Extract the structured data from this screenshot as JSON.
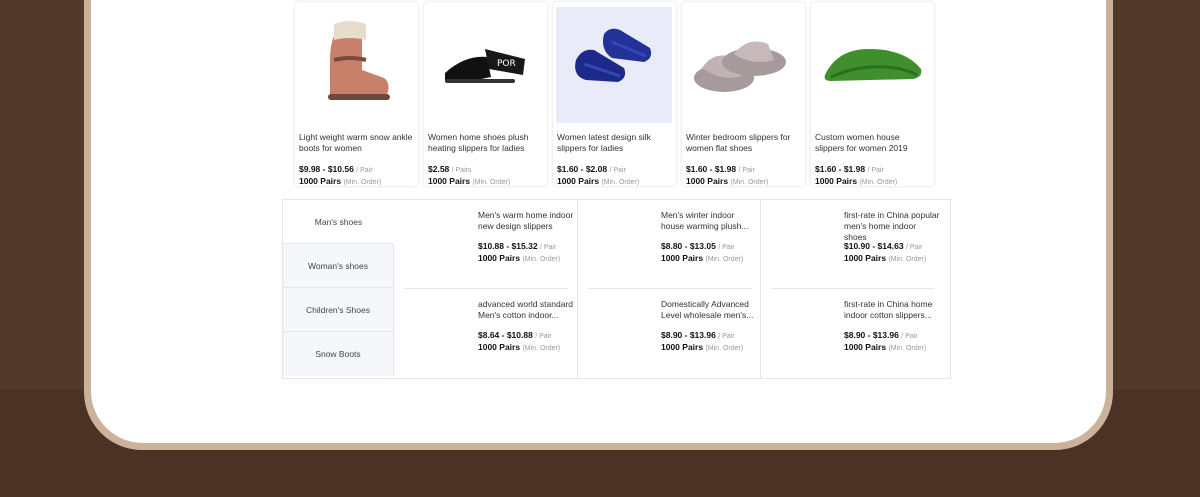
{
  "products": [
    {
      "title": "Light weight warm snow ankle boots for women",
      "price": "$9.98 - $10.56",
      "unit": "/ Pair",
      "moq": "1000 Pairs",
      "moq_note": "(Min. Order)",
      "icon": "snow-boot"
    },
    {
      "title": "Women home shoes plush heating slippers for ladies",
      "price": "$2.58",
      "unit": "/ Pairs",
      "moq": "1000 Pairs",
      "moq_note": "(Min. Order)",
      "icon": "sport-slide"
    },
    {
      "title": "Women latest design silk slippers for ladies",
      "price": "$1.60 - $2.08",
      "unit": "/ Pair",
      "moq": "1000 Pairs",
      "moq_note": "(Min. Order)",
      "icon": "silk-slipper"
    },
    {
      "title": "Winter bedroom slippers for women flat shoes",
      "price": "$1.60 - $1.98",
      "unit": "/ Pair",
      "moq": "1000 Pairs",
      "moq_note": "(Min. Order)",
      "icon": "fur-slipper"
    },
    {
      "title": "Custom women house slippers for women 2019",
      "price": "$1.60 - $1.98",
      "unit": "/ Pair",
      "moq": "1000 Pairs",
      "moq_note": "(Min. Order)",
      "icon": "grass-slipper"
    }
  ],
  "categories": [
    "Man's shoes",
    "Woman's shoes",
    "Children's Shoes",
    "Snow Boots"
  ],
  "category_products": [
    {
      "title": "Men's warm home indoor new design slippers",
      "price": "$10.88 - $15.32",
      "unit": "/ Pair",
      "moq": "1000 Pairs",
      "moq_note": "(Min. Order)"
    },
    {
      "title": "Men's winter indoor house warming plush...",
      "price": "$8.80 - $13.05",
      "unit": "/ Pair",
      "moq": "1000 Pairs",
      "moq_note": "(Min. Order)"
    },
    {
      "title": "first-rate in China popular men's home indoor shoes",
      "price": "$10.90 - $14.63",
      "unit": "/ Pair",
      "moq": "1000 Pairs",
      "moq_note": "(Min. Order)"
    },
    {
      "title": "advanced world standard Men's cotton indoor...",
      "price": "$8.64 - $10.88",
      "unit": "/ Pair",
      "moq": "1000 Pairs",
      "moq_note": "(Min. Order)"
    },
    {
      "title": "Domestically Advanced Level wholesale men's...",
      "price": "$8.90 - $13.96",
      "unit": "/ Pair",
      "moq": "1000 Pairs",
      "moq_note": "(Min. Order)"
    },
    {
      "title": "first-rate in China home indoor cotton slippers...",
      "price": "$8.90 - $13.96",
      "unit": "/ Pair",
      "moq": "1000 Pairs",
      "moq_note": "(Min. Order)"
    }
  ],
  "colors": {
    "background": "#4a3324",
    "frame": "#cdb29b",
    "panel": "#ffffff",
    "border": "#e3e6eb"
  }
}
